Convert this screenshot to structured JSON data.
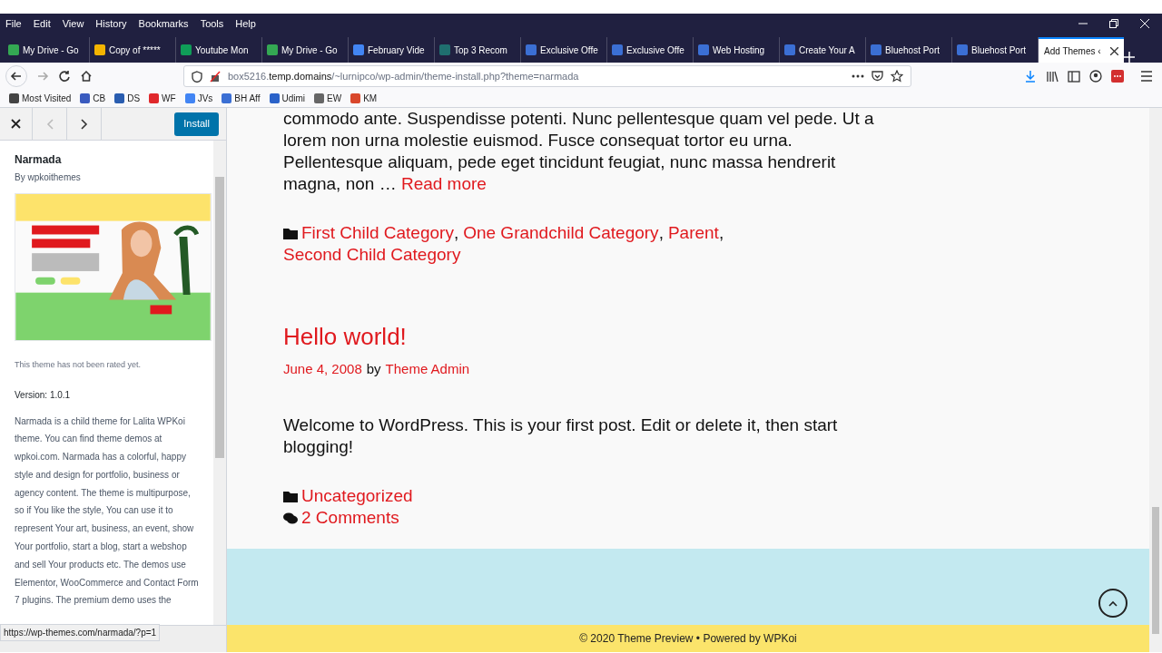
{
  "menu_bar": [
    "File",
    "Edit",
    "View",
    "History",
    "Bookmarks",
    "Tools",
    "Help"
  ],
  "tabs": [
    {
      "label": "My Drive - Go",
      "selected": false,
      "color": "#34a853"
    },
    {
      "label": "Copy of *****",
      "selected": false,
      "color": "#f4b400"
    },
    {
      "label": "Youtube Mon",
      "selected": false,
      "color": "#0f9d58"
    },
    {
      "label": "My Drive - Go",
      "selected": false,
      "color": "#34a853"
    },
    {
      "label": "February Vide",
      "selected": false,
      "color": "#4285f4"
    },
    {
      "label": "Top 3 Recom",
      "selected": false,
      "color": "#1f6f6f"
    },
    {
      "label": "Exclusive Offe",
      "selected": false,
      "color": "#3b6fd4"
    },
    {
      "label": "Exclusive Offe",
      "selected": false,
      "color": "#3b6fd4"
    },
    {
      "label": "Web Hosting",
      "selected": false,
      "color": "#3b6fd4"
    },
    {
      "label": "Create Your A",
      "selected": false,
      "color": "#3b6fd4"
    },
    {
      "label": "Bluehost Port",
      "selected": false,
      "color": "#3b6fd4"
    },
    {
      "label": "Bluehost Port",
      "selected": false,
      "color": "#3b6fd4"
    },
    {
      "label": "Add Themes ‹",
      "selected": true
    }
  ],
  "address": {
    "host_pre": "box5216.",
    "host": "temp.domains",
    "path": "/~lurnipco/wp-admin/theme-install.php?theme=narmada"
  },
  "bookmarks": [
    {
      "label": "Most Visited",
      "color": "#444444"
    },
    {
      "label": "CB",
      "color": "#3a5bbf"
    },
    {
      "label": "DS",
      "color": "#2a5db0"
    },
    {
      "label": "WF",
      "color": "#e0282c"
    },
    {
      "label": "JVs",
      "color": "#4285f4"
    },
    {
      "label": "BH Aff",
      "color": "#3b6fd4"
    },
    {
      "label": "Udimi",
      "color": "#2a62c9"
    },
    {
      "label": "EW",
      "color": "#666666"
    },
    {
      "label": "KM",
      "color": "#d9472b"
    }
  ],
  "sidebar": {
    "install": "Install",
    "name": "Narmada",
    "author": "By wpkoithemes",
    "rating": "This theme has not been rated yet.",
    "version": "Version: 1.0.1",
    "description": "Narmada is a child theme for Lalita WPKoi theme. You can find theme demos at wpkoi.com. Narmada has a colorful, happy style and design for portfolio, business or agency content. The theme is multipurpose, so if You like the style, You can use it to represent Your art, business, an event, show Your portfolio, start a blog, start a webshop and sell Your products etc. The demos use Elementor, WooCommerce and Contact Form 7 plugins. The premium demo uses the"
  },
  "post1": {
    "excerpt": "commodo ante. Suspendisse potenti. Nunc pellentesque quam vel pede. Ut a lorem non urna molestie euismod. Fusce consequat tortor eu urna. Pellentesque aliquam, pede eget tincidunt feugiat, nunc massa hendrerit magna, non …",
    "read_more": "Read more",
    "separator": ",",
    "categories": [
      "First Child Category",
      "One Grandchild Category",
      "Parent",
      "Second Child Category"
    ]
  },
  "post2": {
    "title": "Hello world!",
    "date": "June 4, 2008",
    "by": "by",
    "author": "Theme Admin",
    "body": "Welcome to WordPress. This is your first post. Edit or delete it, then start blogging!",
    "categories": [
      "Uncategorized"
    ],
    "comments": "2 Comments"
  },
  "footer": "© 2020 Theme Preview • Powered by WPKoi",
  "status_url": "https://wp-themes.com/narmada/?p=1"
}
